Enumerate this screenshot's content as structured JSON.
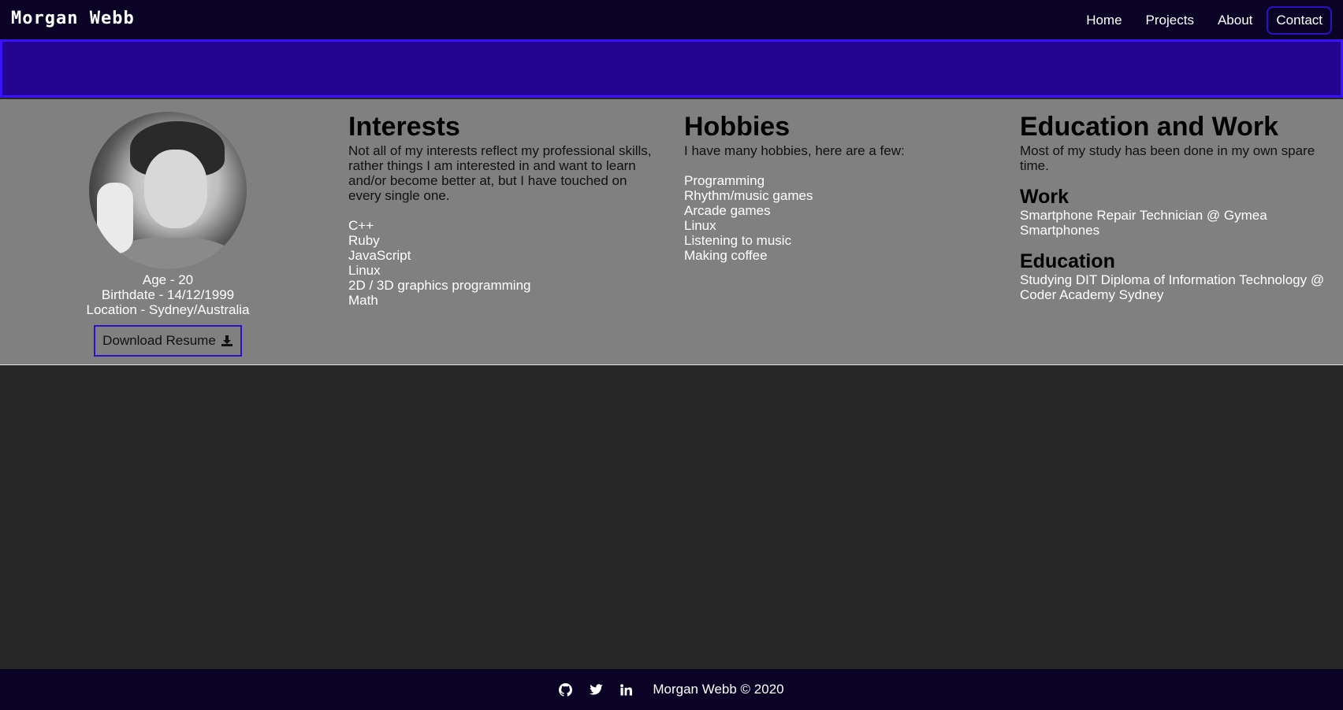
{
  "navbar": {
    "brand": "Morgan Webb",
    "links": [
      {
        "label": "Home"
      },
      {
        "label": "Projects"
      },
      {
        "label": "About"
      },
      {
        "label": "Contact"
      }
    ]
  },
  "profile": {
    "age": "Age - 20",
    "birthdate": "Birthdate - 14/12/1999",
    "location": "Location - Sydney/Australia",
    "download_label": "Download Resume"
  },
  "interests": {
    "title": "Interests",
    "intro": "Not all of my interests reflect my professional skills, rather things I am interested in and want to learn and/or become better at, but I have touched on every single one.",
    "items": [
      "C++",
      "Ruby",
      "JavaScript",
      "Linux",
      "2D / 3D graphics programming",
      "Math"
    ]
  },
  "hobbies": {
    "title": "Hobbies",
    "intro": "I have many hobbies, here are a few:",
    "items": [
      "Programming",
      "Rhythm/music games",
      "Arcade games",
      "Linux",
      "Listening to music",
      "Making coffee"
    ]
  },
  "education_work": {
    "title": "Education and Work",
    "intro": "Most of my study has been done in my own spare time.",
    "work_title": "Work",
    "work_text": "Smartphone Repair Technician @ Gymea Smartphones",
    "education_title": "Education",
    "education_text": "Studying DIT Diploma of Information Technology @ Coder Academy Sydney"
  },
  "footer": {
    "text": "Morgan Webb © 2020",
    "icons": [
      "github-icon",
      "twitter-icon",
      "linkedin-icon"
    ]
  },
  "colors": {
    "nav_bg": "#0a0326",
    "banner_bg": "#22048f",
    "accent_border": "#2b12c9",
    "content_bg": "#808080",
    "page_bg": "#262626"
  }
}
